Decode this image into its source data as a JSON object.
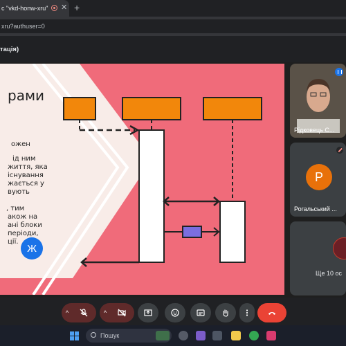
{
  "browser": {
    "tab_title": "c \"vkd-honw-xru\"",
    "new_tab": "+",
    "close": "✕",
    "address": "xru?authuser=0",
    "meeting_title": "тація)"
  },
  "slide": {
    "heading": "рами",
    "lines": [
      "ожен",
      "ід ним",
      "життя, яка",
      "існування",
      "жається у",
      "вують",
      "",
      ", тим",
      "акож на",
      "ані блоки",
      "періоди,",
      "ції."
    ]
  },
  "participants": [
    {
      "name": "Рідковець С...",
      "state": "speaking"
    },
    {
      "name": "Рогальський ...",
      "initial": "Р",
      "state": "muted"
    },
    {
      "initial": "Ж",
      "others_label": "Ще 10 ос"
    }
  ],
  "controls": {
    "caret": "^",
    "mic": "mic-off-icon",
    "camera": "camera-off-icon",
    "present": "present-icon",
    "emoji": "emoji-icon",
    "captions": "captions-icon",
    "hand": "raise-hand-icon",
    "more": "more-icon",
    "leave": "leave-call-icon"
  },
  "taskbar": {
    "search_placeholder": "Пошук"
  },
  "colors": {
    "slide_pink": "#f06b7a",
    "slide_orange": "#f2870b",
    "diagram_purple": "#7b6ee0",
    "leave_red": "#ea4335",
    "avatar_orange": "#e8710a",
    "avatar_blue": "#1a73e8"
  }
}
